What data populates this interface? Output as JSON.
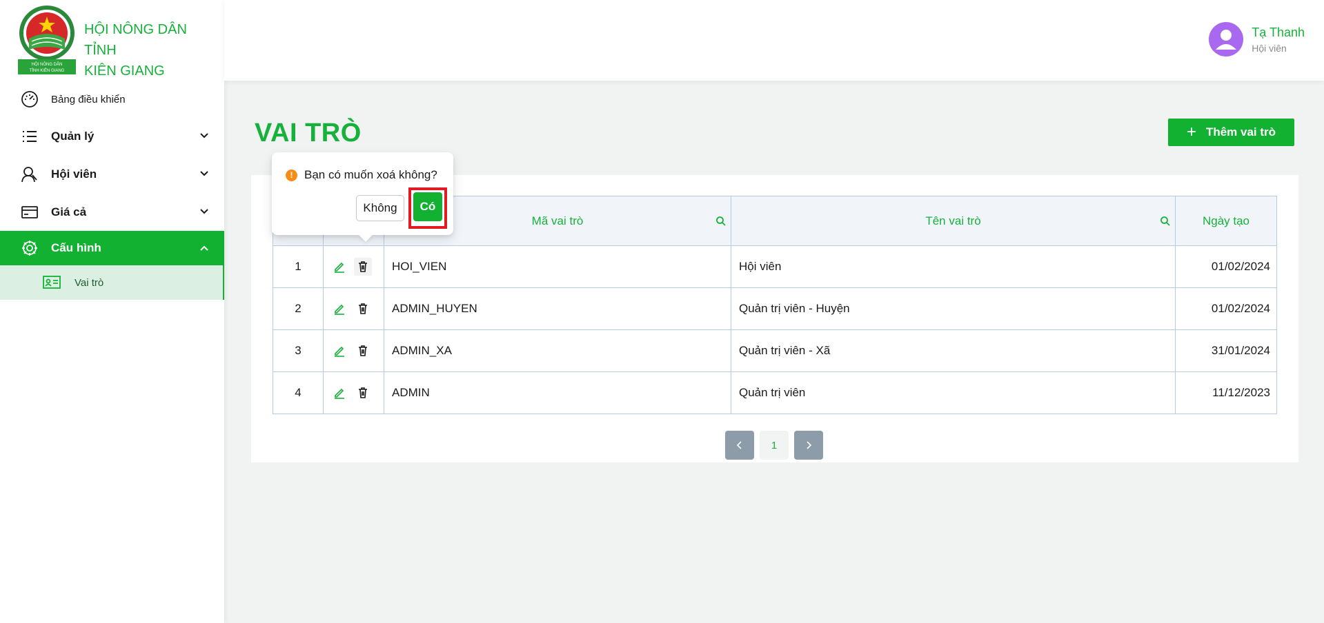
{
  "brand": {
    "line1": "HỘI NÔNG DÂN TỈNH",
    "line2": "KIÊN GIANG",
    "logo_text1": "HỘI NÔNG DÂN",
    "logo_text2": "TỈNH KIÊN GIANG"
  },
  "sidebar": {
    "items": [
      {
        "label": "Bảng điều khiển",
        "icon": "dashboard-icon"
      },
      {
        "label": "Quản lý",
        "icon": "list-icon"
      },
      {
        "label": "Hội viên",
        "icon": "member-icon"
      },
      {
        "label": "Giá cả",
        "icon": "card-icon"
      },
      {
        "label": "Cấu hình",
        "icon": "gear-icon"
      }
    ],
    "sub_items": [
      {
        "label": "Vai trò",
        "icon": "id-card-icon"
      }
    ]
  },
  "user": {
    "name": "Tạ Thanh",
    "role": "Hội viên"
  },
  "page": {
    "title": "VAI TRÒ",
    "add_label": "Thêm vai trò"
  },
  "table": {
    "headers": [
      "Mã vai trò",
      "Tên vai trò",
      "Ngày tạo"
    ],
    "rows": [
      {
        "stt": "1",
        "code": "HOI_VIEN",
        "name": "Hội viên",
        "date": "01/02/2024"
      },
      {
        "stt": "2",
        "code": "ADMIN_HUYEN",
        "name": "Quản trị viên - Huyện",
        "date": "01/02/2024"
      },
      {
        "stt": "3",
        "code": "ADMIN_XA",
        "name": "Quản trị viên - Xã",
        "date": "31/01/2024"
      },
      {
        "stt": "4",
        "code": "ADMIN",
        "name": "Quản trị viên",
        "date": "11/12/2023"
      }
    ]
  },
  "pagination": {
    "current": "1"
  },
  "popconfirm": {
    "message": "Bạn có muốn xoá không?",
    "cancel": "Không",
    "confirm": "Có"
  },
  "colors": {
    "accent": "#13b132",
    "highlight": "#e01b24",
    "warning": "#fa8c16"
  }
}
